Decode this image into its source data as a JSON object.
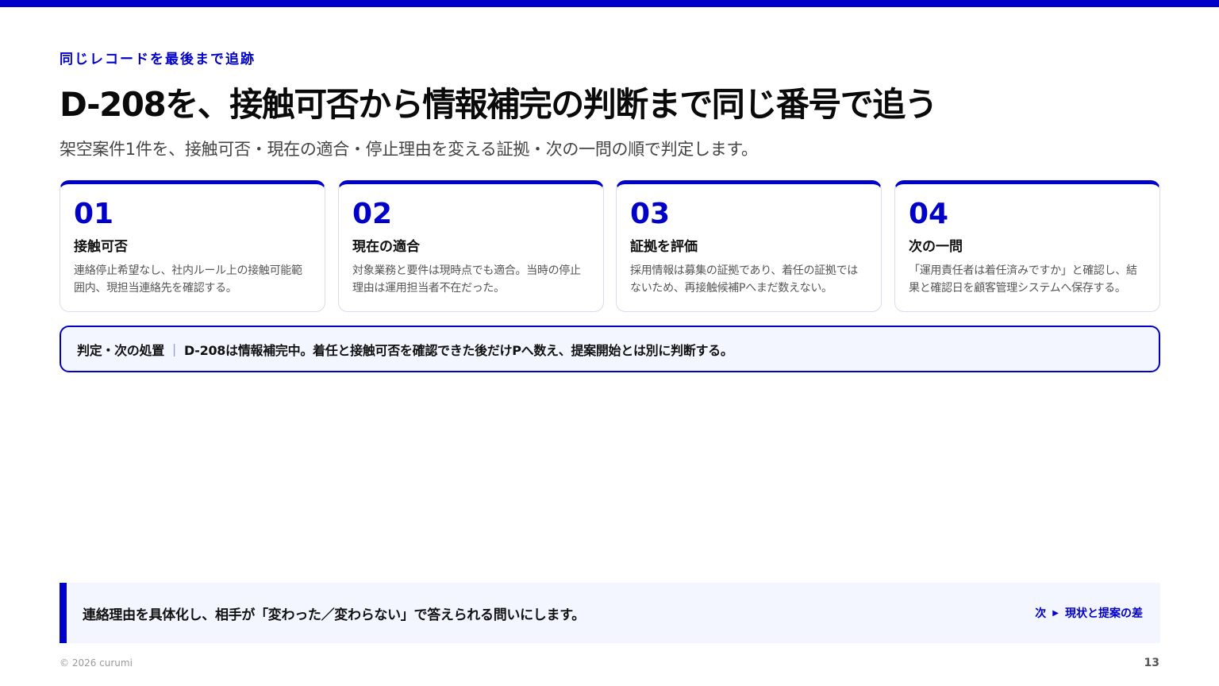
{
  "header": {
    "eyebrow": "同じレコードを最後まで追跡",
    "title": "D-208を、接触可否から情報補完の判断まで同じ番号で追う",
    "subtitle": "架空案件1件を、接触可否・現在の適合・停止理由を変える証拠・次の一問の順で判定します。"
  },
  "cards": [
    {
      "num": "01",
      "title": "接触可否",
      "body": "連絡停止希望なし、社内ルール上の接触可能範囲内、現担当連絡先を確認する。"
    },
    {
      "num": "02",
      "title": "現在の適合",
      "body": "対象業務と要件は現時点でも適合。当時の停止理由は運用担当者不在だった。"
    },
    {
      "num": "03",
      "title": "証拠を評価",
      "body": "採用情報は募集の証拠であり、着任の証拠ではないため、再接触候補Pへまだ数えない。"
    },
    {
      "num": "04",
      "title": "次の一問",
      "body": "「運用責任者は着任済みですか」と確認し、結果と確認日を顧客管理システムへ保存する。"
    }
  ],
  "judgement": {
    "label": "判定・次の処置",
    "text": "D-208は情報補完中。着任と接触可否を確認できた後だけPへ数え、提案開始とは別に判断する。"
  },
  "footer": {
    "message": "連絡理由を具体化し、相手が「変わった／変わらない」で答えられる問いにします。",
    "next_prefix": "次",
    "next_label": "現状と提案の差",
    "copyright": "© 2026 curumi",
    "page_number": "13"
  },
  "colors": {
    "accent": "#0000c8",
    "panel": "#f3f5ff"
  }
}
